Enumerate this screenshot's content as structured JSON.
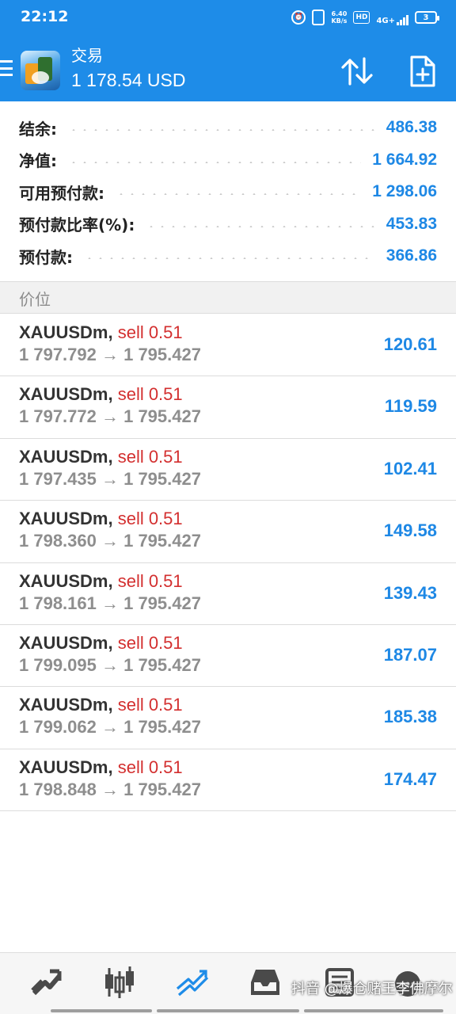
{
  "status_bar": {
    "time": "22:12",
    "speed_value": "6.40",
    "speed_unit": "KB/s",
    "hd": "HD",
    "network": "4G+",
    "battery": "3"
  },
  "header": {
    "title": "交易",
    "balance": "1 178.54 USD"
  },
  "summary": [
    {
      "label": "结余:",
      "value": "486.38"
    },
    {
      "label": "净值:",
      "value": "1 664.92"
    },
    {
      "label": "可用预付款:",
      "value": "1 298.06"
    },
    {
      "label": "预付款比率(%):",
      "value": "453.83"
    },
    {
      "label": "预付款:",
      "value": "366.86"
    }
  ],
  "section_label": "价位",
  "positions": [
    {
      "symbol": "XAUUSDm,",
      "side": "sell 0.51",
      "prices": "1 797.792 → 1 795.427",
      "profit": "120.61"
    },
    {
      "symbol": "XAUUSDm,",
      "side": "sell 0.51",
      "prices": "1 797.772 → 1 795.427",
      "profit": "119.59"
    },
    {
      "symbol": "XAUUSDm,",
      "side": "sell 0.51",
      "prices": "1 797.435 → 1 795.427",
      "profit": "102.41"
    },
    {
      "symbol": "XAUUSDm,",
      "side": "sell 0.51",
      "prices": "1 798.360 → 1 795.427",
      "profit": "149.58"
    },
    {
      "symbol": "XAUUSDm,",
      "side": "sell 0.51",
      "prices": "1 798.161 → 1 795.427",
      "profit": "139.43"
    },
    {
      "symbol": "XAUUSDm,",
      "side": "sell 0.51",
      "prices": "1 799.095 → 1 795.427",
      "profit": "187.07"
    },
    {
      "symbol": "XAUUSDm,",
      "side": "sell 0.51",
      "prices": "1 799.062 → 1 795.427",
      "profit": "185.38"
    },
    {
      "symbol": "XAUUSDm,",
      "side": "sell 0.51",
      "prices": "1 798.848 → 1 795.427",
      "profit": "174.47"
    }
  ],
  "bottom_nav": {
    "items": [
      "quotes-icon",
      "chart-icon",
      "trade-icon",
      "history-icon",
      "news-icon",
      "messages-icon"
    ],
    "active": "trade-icon",
    "watermark": "抖音 @爆仓赌王李佛摩尔"
  },
  "colors": {
    "header_bg": "#1e8ce8",
    "value_blue": "#1e88e5",
    "sell_red": "#d32f2f",
    "price_gray": "#8e8e8e"
  }
}
